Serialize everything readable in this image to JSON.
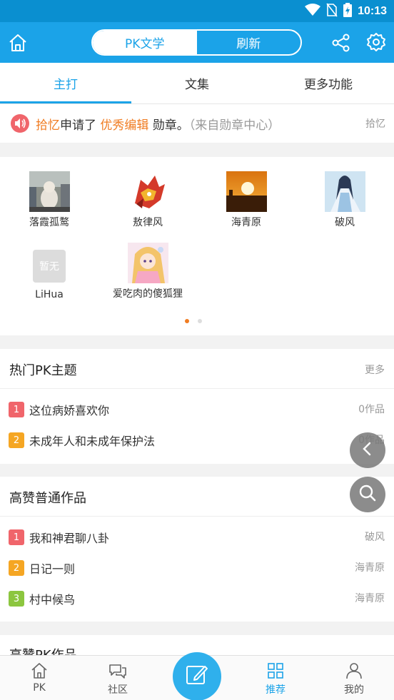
{
  "status_bar": {
    "time": "10:13"
  },
  "header": {
    "segments": [
      {
        "label": "PK文学",
        "active": true
      },
      {
        "label": "刷新",
        "active": false
      }
    ],
    "accent_color": "#1ba3e8"
  },
  "tabs": [
    {
      "label": "主打",
      "active": true
    },
    {
      "label": "文集",
      "active": false
    },
    {
      "label": "更多功能",
      "active": false
    }
  ],
  "notice": {
    "user": "拾忆",
    "action": "申请了",
    "badge": "优秀编辑",
    "suffix": "勋章。",
    "source": "（来自勋章中心）",
    "right": "拾忆"
  },
  "users": [
    {
      "name": "落霞孤鹜",
      "avatar": "cat-photo"
    },
    {
      "name": "敖律风",
      "avatar": "dragon-art"
    },
    {
      "name": "海青原",
      "avatar": "sunset-photo"
    },
    {
      "name": "破风",
      "avatar": "anime-swordsman"
    },
    {
      "name": "LiHua",
      "avatar": "placeholder",
      "placeholder_text": "暂无"
    },
    {
      "name": "爱吃肉的傻狐狸",
      "avatar": "anime-girl"
    }
  ],
  "pager": {
    "count": 2,
    "active": 0
  },
  "hot_topics": {
    "title": "热门PK主题",
    "more": "更多",
    "items": [
      {
        "rank": "1",
        "title": "这位病娇喜欢你",
        "right": "0作品"
      },
      {
        "rank": "2",
        "title": "未成年人和未成年保护法",
        "right": "0作品"
      }
    ]
  },
  "top_works": {
    "title": "高赞普通作品",
    "items": [
      {
        "rank": "1",
        "title": "我和神君聊八卦",
        "right": "破风"
      },
      {
        "rank": "2",
        "title": "日记一则",
        "right": "海青原"
      },
      {
        "rank": "3",
        "title": "村中候鸟",
        "right": "海青原"
      }
    ]
  },
  "top_pk": {
    "title": "高赞PK作品"
  },
  "rank_colors": {
    "1": "#f0656b",
    "2": "#f5a623",
    "3": "#8cc63f"
  },
  "bottom_nav": [
    {
      "label": "PK",
      "icon": "home-icon"
    },
    {
      "label": "社区",
      "icon": "chat-icon"
    },
    {
      "label": "推荐",
      "icon": "grid-icon",
      "active": true
    },
    {
      "label": "我的",
      "icon": "person-icon"
    }
  ]
}
